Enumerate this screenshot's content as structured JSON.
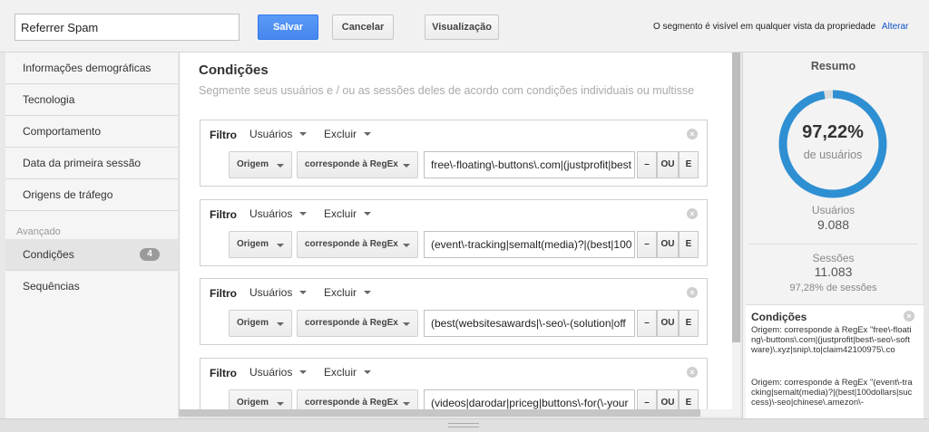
{
  "header": {
    "segment_name": "Referrer Spam",
    "save_label": "Salvar",
    "cancel_label": "Cancelar",
    "preview_label": "Visualização",
    "visibility_text": "O segmento é visível em qualquer vista da propriedade",
    "change_link": "Alterar",
    "colors": {
      "primary": "#4787ed"
    }
  },
  "sidebar": {
    "items": [
      {
        "label": "Informações demográficas"
      },
      {
        "label": "Tecnologia"
      },
      {
        "label": "Comportamento"
      },
      {
        "label": "Data da primeira sessão"
      },
      {
        "label": "Origens de tráfego"
      }
    ],
    "advanced_heading": "Avançado",
    "advanced_items": [
      {
        "label": "Condições",
        "badge": "4",
        "active": true
      },
      {
        "label": "Sequências"
      }
    ]
  },
  "main": {
    "title": "Condições",
    "subtitle": "Segmente seus usuários e / ou as sessões deles de acordo com condições individuais ou multisse",
    "filters": [
      {
        "label": "Filtro",
        "scope": "Usuários",
        "mode": "Excluir",
        "dimension": "Origem",
        "operator": "corresponde à RegEx",
        "value": "free\\-floating\\-buttons\\.com|(justprofit|best",
        "minus": "–",
        "or": "OU",
        "and": "E"
      },
      {
        "label": "Filtro",
        "scope": "Usuários",
        "mode": "Excluir",
        "dimension": "Origem",
        "operator": "corresponde à RegEx",
        "value": "(event\\-tracking|semalt(media)?|(best|100",
        "minus": "–",
        "or": "OU",
        "and": "E"
      },
      {
        "label": "Filtro",
        "scope": "Usuários",
        "mode": "Excluir",
        "dimension": "Origem",
        "operator": "corresponde à RegEx",
        "value": "(best(websitesawards|\\-seo\\-(solution|off",
        "minus": "–",
        "or": "OU",
        "and": "E"
      },
      {
        "label": "Filtro",
        "scope": "Usuários",
        "mode": "Excluir",
        "dimension": "Origem",
        "operator": "corresponde à RegEx",
        "value": "(videos|darodar|priceg|buttons\\-for(\\-your",
        "minus": "–",
        "or": "OU",
        "and": "E"
      }
    ]
  },
  "summary": {
    "title": "Resumo",
    "percent": "97,22%",
    "percent_value": 0.9722,
    "percent_label": "de usuários",
    "users_label": "Usuários",
    "users_value": "9.088",
    "sessions_label": "Sessões",
    "sessions_value": "11.083",
    "sessions_pct": "97,28% de sessões",
    "ring_color": "#2e8fd3",
    "conditions_title": "Condições",
    "conditions": [
      "Origem: corresponde à RegEx \"free\\-floating\\-buttons\\.com|(justprofit|best\\-seo\\-software)\\.xyz|snip\\.to|claim42100975\\.co",
      "Origem: corresponde à RegEx \"(event\\-tracking|semalt(media)?|(best|100dollars|success)\\-seo|chinese\\.amezon\\-"
    ]
  }
}
